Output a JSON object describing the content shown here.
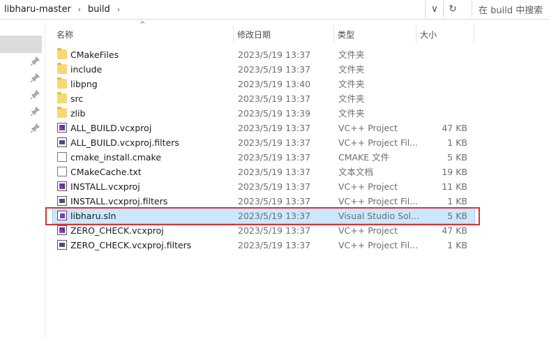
{
  "address": {
    "crumbs": [
      "libharu-master",
      "build"
    ],
    "separator": "›",
    "dropdown_glyph": "∨",
    "refresh_glyph": "↻",
    "search_placeholder": "在 build 中搜索"
  },
  "columns": {
    "name": "名称",
    "date": "修改日期",
    "type": "类型",
    "size": "大小",
    "sort_glyph": "^"
  },
  "files": [
    {
      "name": "CMakeFiles",
      "date": "2023/5/19 13:37",
      "type": "文件夹",
      "size": "",
      "icon": "folder"
    },
    {
      "name": "include",
      "date": "2023/5/19 13:37",
      "type": "文件夹",
      "size": "",
      "icon": "folder"
    },
    {
      "name": "libpng",
      "date": "2023/5/19 13:40",
      "type": "文件夹",
      "size": "",
      "icon": "folder"
    },
    {
      "name": "src",
      "date": "2023/5/19 13:37",
      "type": "文件夹",
      "size": "",
      "icon": "folder"
    },
    {
      "name": "zlib",
      "date": "2023/5/19 13:39",
      "type": "文件夹",
      "size": "",
      "icon": "folder"
    },
    {
      "name": "ALL_BUILD.vcxproj",
      "date": "2023/5/19 13:37",
      "type": "VC++ Project",
      "size": "47 KB",
      "icon": "vcxproj"
    },
    {
      "name": "ALL_BUILD.vcxproj.filters",
      "date": "2023/5/19 13:37",
      "type": "VC++ Project Fil...",
      "size": "1 KB",
      "icon": "filters"
    },
    {
      "name": "cmake_install.cmake",
      "date": "2023/5/19 13:37",
      "type": "CMAKE 文件",
      "size": "5 KB",
      "icon": "document"
    },
    {
      "name": "CMakeCache.txt",
      "date": "2023/5/19 13:37",
      "type": "文本文档",
      "size": "19 KB",
      "icon": "document"
    },
    {
      "name": "INSTALL.vcxproj",
      "date": "2023/5/19 13:37",
      "type": "VC++ Project",
      "size": "11 KB",
      "icon": "vcxproj"
    },
    {
      "name": "INSTALL.vcxproj.filters",
      "date": "2023/5/19 13:37",
      "type": "VC++ Project Fil...",
      "size": "1 KB",
      "icon": "filters"
    },
    {
      "name": "libharu.sln",
      "date": "2023/5/19 13:37",
      "type": "Visual Studio Sol...",
      "size": "5 KB",
      "icon": "solution",
      "selected": true
    },
    {
      "name": "ZERO_CHECK.vcxproj",
      "date": "2023/5/19 13:37",
      "type": "VC++ Project",
      "size": "47 KB",
      "icon": "vcxproj"
    },
    {
      "name": "ZERO_CHECK.vcxproj.filters",
      "date": "2023/5/19 13:37",
      "type": "VC++ Project Fil...",
      "size": "1 KB",
      "icon": "filters"
    }
  ],
  "colors": {
    "selection": "#cce8ff",
    "highlight_box": "#e03030",
    "folder": "#f8d775"
  }
}
